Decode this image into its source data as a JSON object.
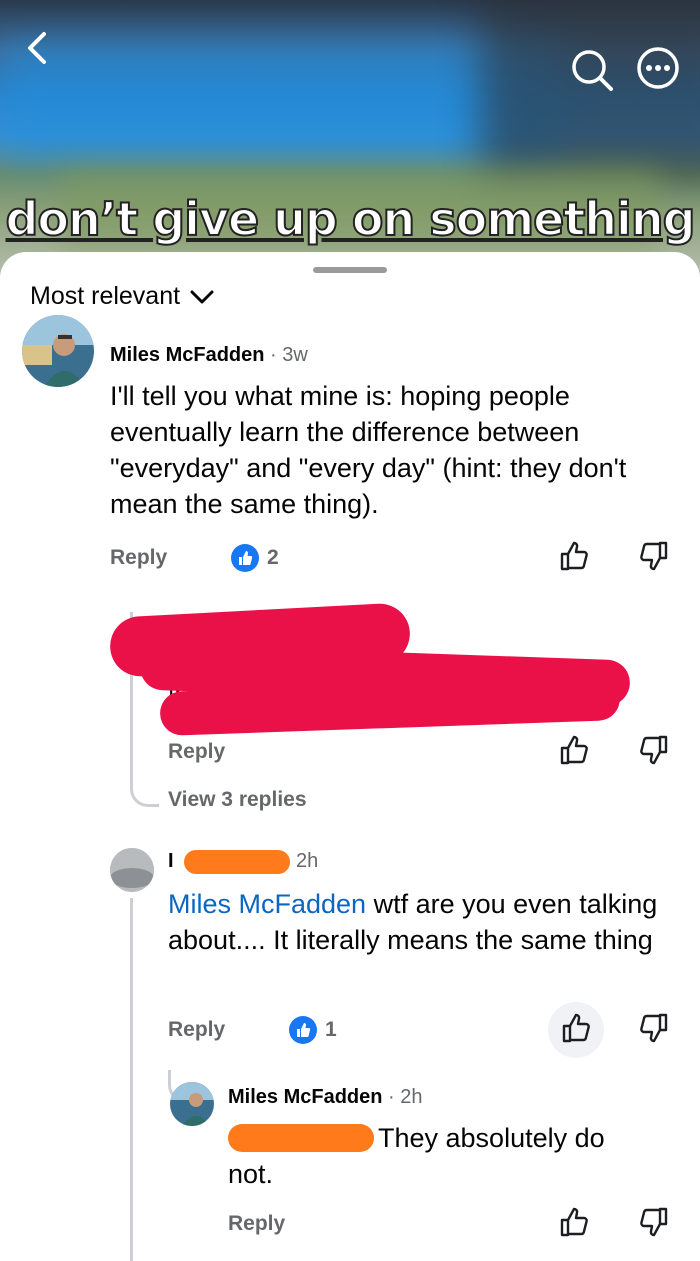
{
  "video": {
    "caption": "don’t give up on something",
    "icons": [
      "back-icon",
      "search-icon",
      "more-icon"
    ]
  },
  "sheet": {
    "sort_label": "Most relevant"
  },
  "comments": [
    {
      "author": "Miles McFadden",
      "time": "3w",
      "text": "I'll tell you what mine is: hoping people eventually learn the difference between \"everyday\" and \"every day\" (hint: they don't mean the same thing).",
      "reply_label": "Reply",
      "like_count": "2"
    },
    {
      "redacted_fragment": "fr",
      "reply_label": "Reply",
      "view_replies": "View 3 replies"
    },
    {
      "author_initial": "I",
      "time": "2h",
      "mention": "Miles McFadden",
      "text": " wtf are you even talking about.... It literally means the same thing",
      "reply_label": "Reply",
      "like_count": "1"
    },
    {
      "author": "Miles McFadden",
      "time": "2h",
      "text": "They absolutely do not.",
      "reply_label": "Reply"
    }
  ],
  "colors": {
    "accent": "#1877f2",
    "mention": "#0a66c2",
    "redact_red": "#ea1149",
    "redact_orange": "#ff7a1a"
  }
}
